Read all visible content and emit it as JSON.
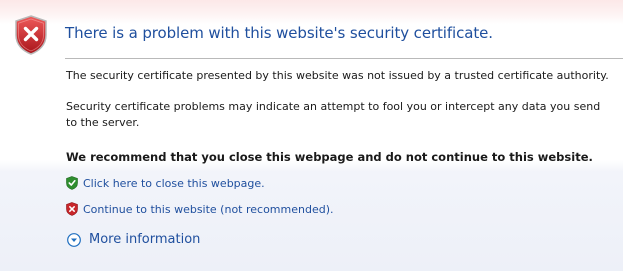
{
  "error": {
    "title": "There is a problem with this website's security certificate.",
    "icon": "security-error-shield-icon",
    "paragraphs": [
      "The security certificate presented by this website was not issued by a trusted certificate authority.",
      "Security certificate problems may indicate an attempt to fool you or intercept any data you send to the server."
    ],
    "recommendation": "We recommend that you close this webpage and do not continue to this website."
  },
  "actions": {
    "close_label": "Click here to close this webpage.",
    "continue_label": "Continue to this website (not recommended).",
    "more_info_label": "More information"
  },
  "colors": {
    "link": "#1f4f9e",
    "shield_red": "#c8262b",
    "shield_green": "#2f8e2f"
  }
}
